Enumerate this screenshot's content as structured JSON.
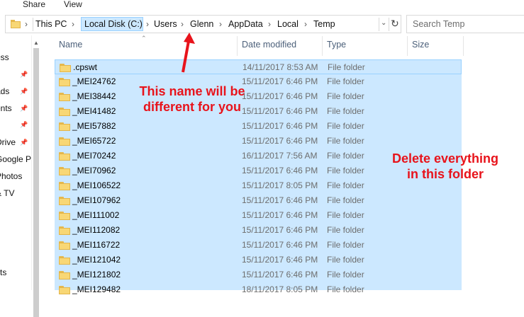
{
  "ribbon": {
    "tabs": [
      "Share",
      "View"
    ]
  },
  "address": {
    "segments": [
      "This PC",
      "Local Disk (C:)",
      "Users",
      "Glenn",
      "AppData",
      "Local",
      "Temp"
    ],
    "search_placeholder": "Search Temp"
  },
  "nav": {
    "items": [
      "ess",
      "ads",
      "ents",
      "Drive",
      "Google P",
      "Photos",
      "& TV",
      "n",
      "cts"
    ]
  },
  "columns": [
    "Name",
    "Date modified",
    "Type",
    "Size"
  ],
  "rows": [
    {
      "name": ".cpswt",
      "date": "14/11/2017 8:53 AM",
      "type": "File folder"
    },
    {
      "name": "_MEI24762",
      "date": "15/11/2017 6:46 PM",
      "type": "File folder"
    },
    {
      "name": "_MEI38442",
      "date": "15/11/2017 6:46 PM",
      "type": "File folder"
    },
    {
      "name": "_MEI41482",
      "date": "15/11/2017 6:46 PM",
      "type": "File folder"
    },
    {
      "name": "_MEI57882",
      "date": "15/11/2017 6:46 PM",
      "type": "File folder"
    },
    {
      "name": "_MEI65722",
      "date": "15/11/2017 6:46 PM",
      "type": "File folder"
    },
    {
      "name": "_MEI70242",
      "date": "16/11/2017 7:56 AM",
      "type": "File folder"
    },
    {
      "name": "_MEI70962",
      "date": "15/11/2017 6:46 PM",
      "type": "File folder"
    },
    {
      "name": "_MEI106522",
      "date": "15/11/2017 8:05 PM",
      "type": "File folder"
    },
    {
      "name": "_MEI107962",
      "date": "15/11/2017 6:46 PM",
      "type": "File folder"
    },
    {
      "name": "_MEI111002",
      "date": "15/11/2017 6:46 PM",
      "type": "File folder"
    },
    {
      "name": "_MEI112082",
      "date": "15/11/2017 6:46 PM",
      "type": "File folder"
    },
    {
      "name": "_MEI116722",
      "date": "15/11/2017 6:46 PM",
      "type": "File folder"
    },
    {
      "name": "_MEI121042",
      "date": "15/11/2017 6:46 PM",
      "type": "File folder"
    },
    {
      "name": "_MEI121802",
      "date": "15/11/2017 6:46 PM",
      "type": "File folder"
    },
    {
      "name": "_MEI129482",
      "date": "18/11/2017 8:05 PM",
      "type": "File folder"
    }
  ],
  "annotations": {
    "name_note_line1": "This name will be",
    "name_note_line2": "different for you",
    "delete_note_line1": "Delete everything",
    "delete_note_line2": "in this folder"
  },
  "colors": {
    "selection": "#cce8ff",
    "annotation": "#e8131b"
  }
}
